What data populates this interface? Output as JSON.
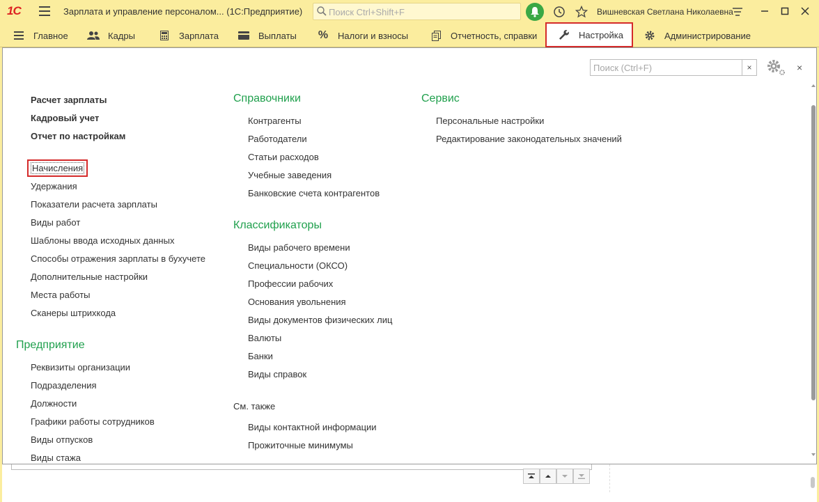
{
  "titlebar": {
    "logo": "1С",
    "app_title": "Зарплата и управление персоналом...  (1С:Предприятие)",
    "search_placeholder": "Поиск Ctrl+Shift+F",
    "user_name": "Вишневская Светлана Николаевна"
  },
  "navbar": {
    "items": [
      {
        "label": "Главное",
        "icon": "menu-icon"
      },
      {
        "label": "Кадры",
        "icon": "people-icon"
      },
      {
        "label": "Зарплата",
        "icon": "calculator-icon"
      },
      {
        "label": "Выплаты",
        "icon": "wallet-icon"
      },
      {
        "label": "Налоги и взносы",
        "icon": "percent-icon"
      },
      {
        "label": "Отчетность, справки",
        "icon": "reports-icon"
      },
      {
        "label": "Настройка",
        "icon": "wrench-icon",
        "active": true
      },
      {
        "label": "Администрирование",
        "icon": "gear-icon"
      }
    ]
  },
  "panel": {
    "search_placeholder": "Поиск (Ctrl+F)",
    "col1": {
      "bold_links": [
        "Расчет зарплаты",
        "Кадровый учет",
        "Отчет по настройкам"
      ],
      "links": [
        "Начисления",
        "Удержания",
        "Показатели расчета зарплаты",
        "Виды работ",
        "Шаблоны ввода исходных данных",
        "Способы отражения зарплаты в бухучете",
        "Дополнительные настройки",
        "Места работы",
        "Сканеры штрихкода"
      ],
      "section2_title": "Предприятие",
      "section2_links": [
        "Реквизиты организации",
        "Подразделения",
        "Должности",
        "Графики работы сотрудников",
        "Виды отпусков",
        "Виды стажа"
      ]
    },
    "col2": {
      "section1_title": "Справочники",
      "section1_links": [
        "Контрагенты",
        "Работодатели",
        "Статьи расходов",
        "Учебные заведения",
        "Банковские счета контрагентов"
      ],
      "section2_title": "Классификаторы",
      "section2_links": [
        "Виды рабочего времени",
        "Специальности (ОКСО)",
        "Профессии рабочих",
        "Основания увольнения",
        "Виды документов физических лиц",
        "Валюты",
        "Банки",
        "Виды справок"
      ],
      "see_also_title": "См. также",
      "see_also_links": [
        "Виды контактной информации",
        "Прожиточные минимумы"
      ]
    },
    "col3": {
      "section1_title": "Сервис",
      "section1_links": [
        "Персональные настройки",
        "Редактирование законодательных значений"
      ]
    }
  },
  "colors": {
    "accent_green": "#20a04d",
    "toolbar_yellow": "#fbed9e",
    "highlight_red": "#d42a2a"
  }
}
